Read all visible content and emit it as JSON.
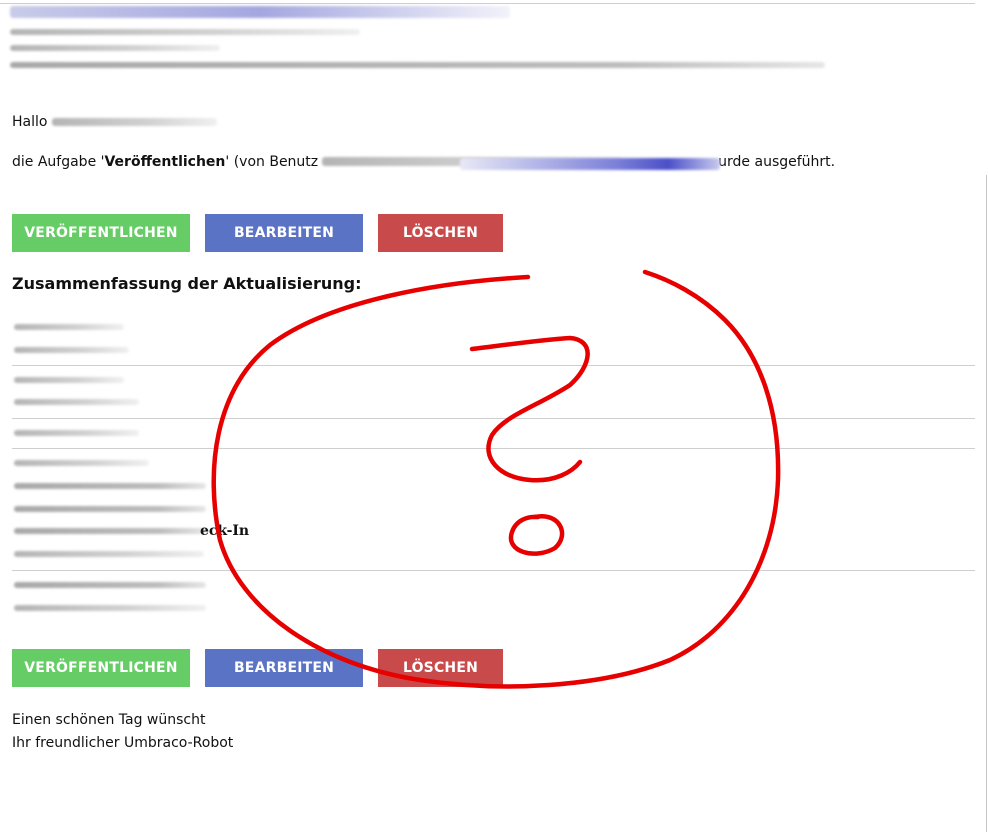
{
  "greeting": "Hallo",
  "task_message": {
    "prefix": "die Aufgabe '",
    "task_name": "Veröffentlichen",
    "middle": "' (von Benutz",
    "suffix": "urde ausgeführt."
  },
  "buttons_top": {
    "publish": "VERÖFFENTLICHEN",
    "edit": "BEARBEITEN",
    "delete": "LÖSCHEN"
  },
  "summary_title": "Zusammenfassung der Aktualisierung:",
  "summary_partial_text": "eck-In",
  "buttons_bottom": {
    "publish": "VERÖFFENTLICHEN",
    "edit": "BEARBEITEN",
    "delete": "LÖSCHEN"
  },
  "closing": {
    "line1": "Einen schönen Tag wünscht",
    "line2": "Ihr freundlicher Umbraco-Robot"
  },
  "colors": {
    "publish_button": "#66cc66",
    "edit_button": "#5a73c4",
    "delete_button": "#c94a4a",
    "annotation_stroke": "#e60000"
  },
  "annotation_icon": "question-mark-annotation"
}
